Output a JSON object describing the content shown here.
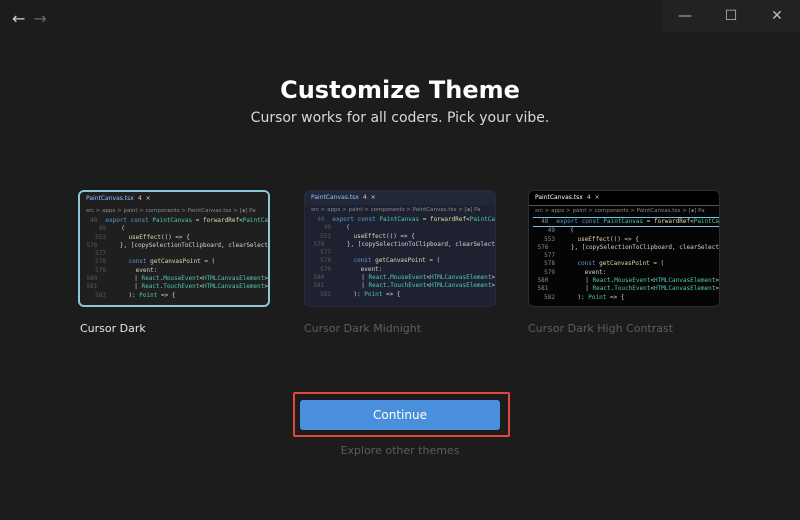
{
  "window": {
    "nav_back": "←",
    "nav_forward": "→",
    "controls": {
      "minimize": "—",
      "maximize": "☐",
      "close": "✕"
    }
  },
  "header": {
    "title": "Customize Theme",
    "subtitle": "Cursor works for all coders. Pick your vibe."
  },
  "preview": {
    "tab_file": "PaintCanvas.tsx",
    "tab_count": "4",
    "tab_close": "×",
    "breadcrumb": "src > apps > paint > components > PaintCanvas.tsx > [∎] Pa",
    "lines": [
      {
        "n": "48",
        "code": "export const PaintCanvas = forwardRef<PaintCa"
      },
      {
        "n": "49",
        "code": "  ("
      },
      {
        "n": "553",
        "code": "    useEffect(() => {"
      },
      {
        "n": "576",
        "code": "    }, [copySelectionToClipboard, clearSelect"
      },
      {
        "n": "577",
        "code": ""
      },
      {
        "n": "578",
        "code": "    const getCanvasPoint = ("
      },
      {
        "n": "579",
        "code": "      event:"
      },
      {
        "n": "580",
        "code": "        | React.MouseEvent<HTMLCanvasElement>"
      },
      {
        "n": "581",
        "code": "        | React.TouchEvent<HTMLCanvasElement>"
      },
      {
        "n": "582",
        "code": "    ): Point => {"
      }
    ]
  },
  "themes": [
    {
      "name": "Cursor Dark",
      "selected": true
    },
    {
      "name": "Cursor Dark Midnight",
      "selected": false
    },
    {
      "name": "Cursor Dark High Contrast",
      "selected": false
    }
  ],
  "actions": {
    "continue_label": "Continue",
    "explore_label": "Explore other themes"
  },
  "colors": {
    "accent": "#4a8fdc",
    "selected_border": "#8fc6dc",
    "focus_ring": "#e0483e"
  }
}
